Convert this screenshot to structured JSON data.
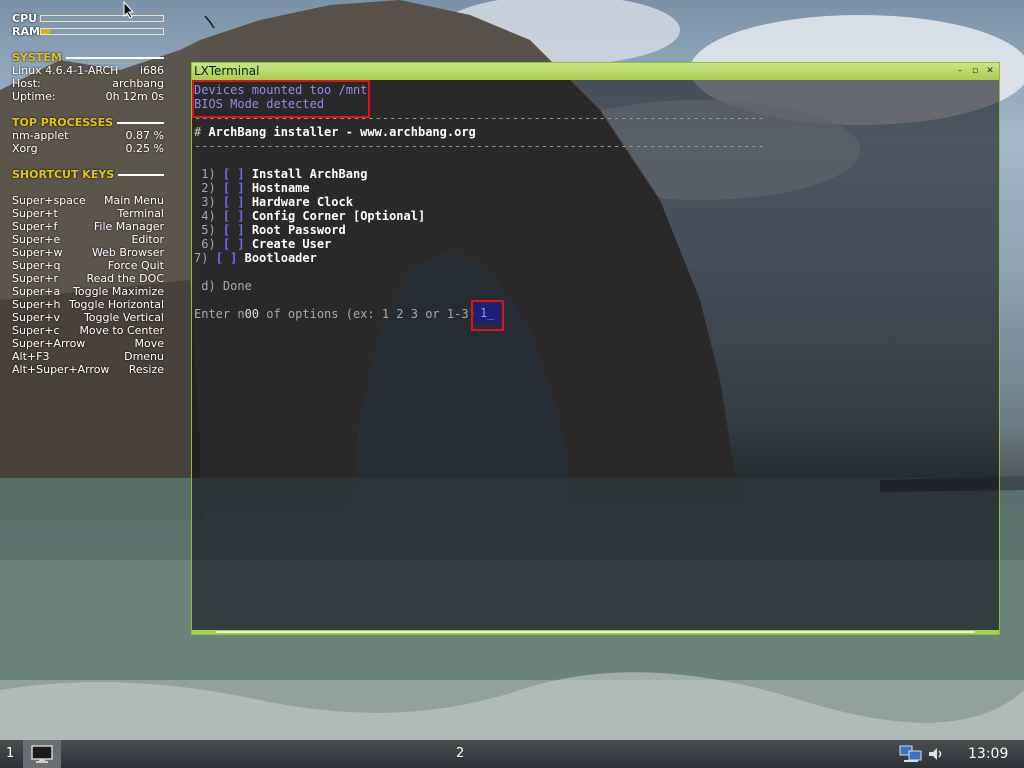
{
  "conky": {
    "cpu_label": "CPU",
    "ram_label": "RAM",
    "cpu_usage": 0.0,
    "ram_usage": 0.07,
    "meter_color": "#d6b21b",
    "system_header": "SYSTEM",
    "system": [
      {
        "key": "Linux 4.6.4-1-ARCH",
        "value": "i686"
      },
      {
        "key": "Host:",
        "value": "archbang"
      },
      {
        "key": "Uptime:",
        "value": "0h 12m 0s"
      }
    ],
    "processes_header": "TOP PROCESSES",
    "processes": [
      {
        "name": "nm-applet",
        "value": "0.87 %"
      },
      {
        "name": "Xorg",
        "value": "0.25 %"
      }
    ],
    "shortcuts_header": "SHORTCUT KEYS",
    "shortcuts": [
      {
        "key": "Super+space",
        "action": "Main Menu"
      },
      {
        "key": "Super+t",
        "action": "Terminal"
      },
      {
        "key": "Super+f",
        "action": "File Manager"
      },
      {
        "key": "Super+e",
        "action": "Editor"
      },
      {
        "key": "Super+w",
        "action": "Web Browser"
      },
      {
        "key": "Super+q",
        "action": "Force Quit"
      },
      {
        "key": "Super+r",
        "action": "Read the DOC"
      },
      {
        "key": "Super+a",
        "action": "Toggle Maximize"
      },
      {
        "key": "Super+h",
        "action": "Toggle Horizontal"
      },
      {
        "key": "Super+v",
        "action": "Toggle Vertical"
      },
      {
        "key": "Super+c",
        "action": "Move to Center"
      },
      {
        "key": "Super+Arrow",
        "action": "Move"
      },
      {
        "key": "Alt+F3",
        "action": "Dmenu"
      },
      {
        "key": "Alt+Super+Arrow",
        "action": "Resize"
      }
    ]
  },
  "terminal": {
    "title": "LXTerminal",
    "accent": "#a7cf4c",
    "buttons": {
      "minimize": "minimize-icon",
      "maximize": "maximize-icon",
      "close": "close-icon"
    },
    "lines": {
      "msg1": "Devices mounted too /mnt",
      "msg2": "BIOS Mode detected",
      "dashes": "-------------------------------------------------------------------------------",
      "header_hash": "# ",
      "header": "ArchBang installer - www.archbang.org",
      "done": "d) Done",
      "prompt_a": "Enter n",
      "prompt_overstrike": "00",
      "prompt_b": " of options (ex: 1 2 3 or 1-3):",
      "input_value": "1_"
    },
    "menu": [
      {
        "num": " 1) ",
        "box": "[ ]",
        "label": " Install ArchBang"
      },
      {
        "num": " 2) ",
        "box": "[ ]",
        "label": " Hostname"
      },
      {
        "num": " 3) ",
        "box": "[ ]",
        "label": " Hardware Clock"
      },
      {
        "num": " 4) ",
        "box": "[ ]",
        "label": " Config Corner [Optional]"
      },
      {
        "num": " 5) ",
        "box": "[ ]",
        "label": " Root Password"
      },
      {
        "num": " 6) ",
        "box": "[ ]",
        "label": " Create User"
      },
      {
        "num": "7) ",
        "box": "[ ]",
        "label": " Bootloader"
      }
    ],
    "highlight_color": "#e01020"
  },
  "taskbar": {
    "desktop_1": "1",
    "desktop_2": "2",
    "clock": "13:09",
    "icons": {
      "terminal_task": "terminal-icon",
      "network": "network-icon",
      "volume": "volume-icon"
    }
  }
}
